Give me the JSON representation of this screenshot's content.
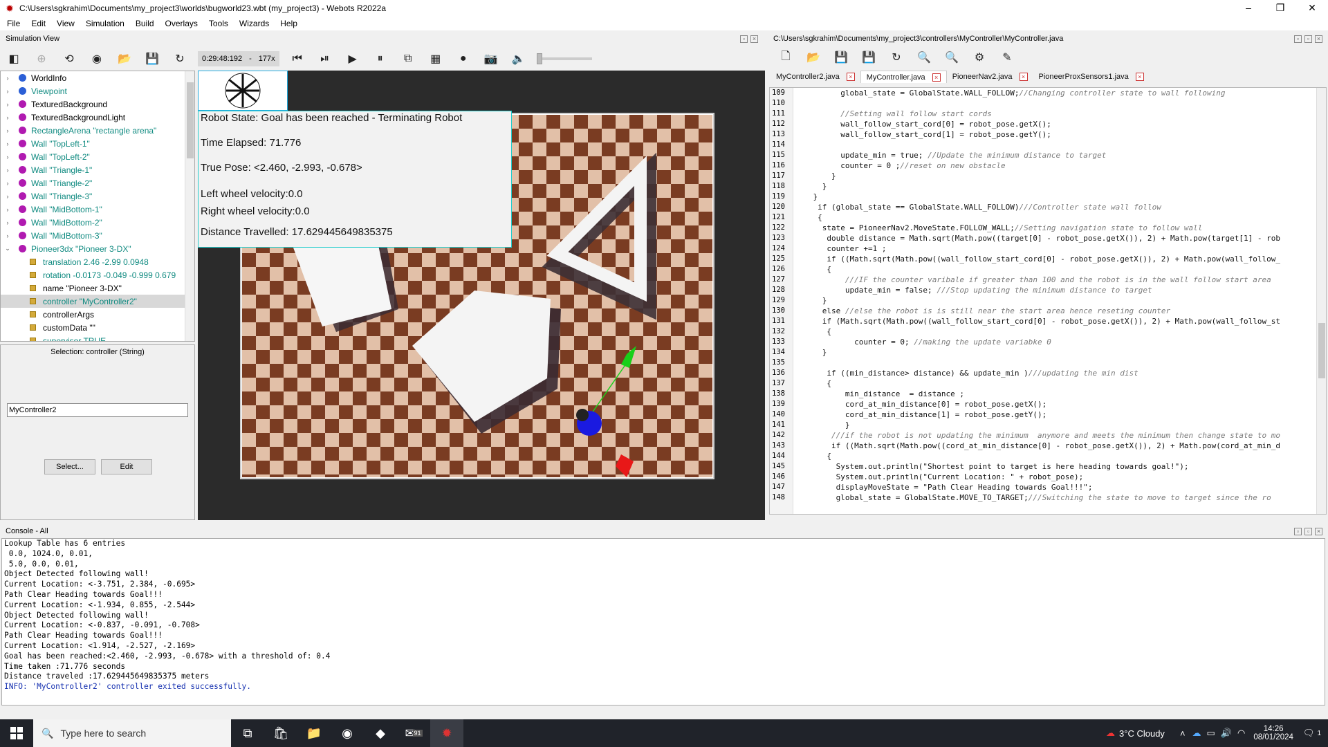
{
  "window": {
    "title": "C:\\Users\\sgkrahim\\Documents\\my_project3\\worlds\\bugworld23.wbt (my_project3) - Webots R2022a"
  },
  "menu": [
    "File",
    "Edit",
    "View",
    "Simulation",
    "Build",
    "Overlays",
    "Tools",
    "Wizards",
    "Help"
  ],
  "simulation": {
    "panel_title": "Simulation View",
    "time": "0:29:48:192",
    "sep": "-",
    "speed": "177x"
  },
  "scene_tree": [
    {
      "label": "WorldInfo",
      "color": "#2b5fd6",
      "type": "node",
      "expand": "›"
    },
    {
      "label": "Viewpoint",
      "color": "#2b5fd6",
      "type": "node",
      "expand": "›",
      "teal": true
    },
    {
      "label": "TexturedBackground",
      "color": "#b01ab0",
      "type": "node",
      "expand": "›"
    },
    {
      "label": "TexturedBackgroundLight",
      "color": "#b01ab0",
      "type": "node",
      "expand": "›"
    },
    {
      "label": "RectangleArena \"rectangle arena\"",
      "color": "#b01ab0",
      "type": "node",
      "expand": "›",
      "teal": true
    },
    {
      "label": "Wall \"TopLeft-1\"",
      "color": "#b01ab0",
      "type": "node",
      "expand": "›",
      "teal": true
    },
    {
      "label": "Wall \"TopLeft-2\"",
      "color": "#b01ab0",
      "type": "node",
      "expand": "›",
      "teal": true
    },
    {
      "label": "Wall \"Triangle-1\"",
      "color": "#b01ab0",
      "type": "node",
      "expand": "›",
      "teal": true
    },
    {
      "label": "Wall \"Triangle-2\"",
      "color": "#b01ab0",
      "type": "node",
      "expand": "›",
      "teal": true
    },
    {
      "label": "Wall \"Triangle-3\"",
      "color": "#b01ab0",
      "type": "node",
      "expand": "›",
      "teal": true
    },
    {
      "label": "Wall \"MidBottom-1\"",
      "color": "#b01ab0",
      "type": "node",
      "expand": "›",
      "teal": true
    },
    {
      "label": "Wall \"MidBottom-2\"",
      "color": "#b01ab0",
      "type": "node",
      "expand": "›",
      "teal": true
    },
    {
      "label": "Wall \"MidBottom-3\"",
      "color": "#b01ab0",
      "type": "node",
      "expand": "›",
      "teal": true
    },
    {
      "label": "Pioneer3dx \"Pioneer 3-DX\"",
      "color": "#b01ab0",
      "type": "node",
      "expand": "⌄",
      "teal": true
    },
    {
      "label": "translation 2.46 -2.99 0.0948",
      "type": "field",
      "teal": true
    },
    {
      "label": "rotation -0.0173 -0.049 -0.999 0.679",
      "type": "field",
      "teal": true
    },
    {
      "label": "name \"Pioneer 3-DX\"",
      "type": "field"
    },
    {
      "label": "controller \"MyController2\"",
      "type": "field",
      "teal": true,
      "selected": true
    },
    {
      "label": "controllerArgs",
      "type": "field"
    },
    {
      "label": "customData \"\"",
      "type": "field"
    },
    {
      "label": "supervisor TRUE",
      "type": "field",
      "teal": true
    }
  ],
  "selection": {
    "label": "Selection: controller (String)",
    "value": "MyController2",
    "select_button": "Select...",
    "edit_button": "Edit"
  },
  "overlay": {
    "state": "Robot State: Goal has been reached - Terminating Robot",
    "time_elapsed": "Time Elapsed: 71.776",
    "true_pose": "True Pose: <2.460, -2.993, -0.678>",
    "left_wheel": "Left wheel velocity:0.0",
    "right_wheel": "Right wheel velocity:0.0",
    "distance": "Distance Travelled: 17.629445649835375"
  },
  "editor": {
    "path": "C:\\Users\\sgkrahim\\Documents\\my_project3\\controllers\\MyController\\MyController.java",
    "tabs": [
      {
        "label": "MyController2.java",
        "active": false
      },
      {
        "label": "MyController.java",
        "active": true
      },
      {
        "label": "PioneerNav2.java",
        "active": false
      },
      {
        "label": "PioneerProxSensors1.java",
        "active": false
      }
    ],
    "line_numbers": [
      "109",
      "110",
      "111",
      "112",
      "113",
      "114",
      "115",
      "116",
      "117",
      "118",
      "119",
      "120",
      "121",
      "122",
      "123",
      "124",
      "125",
      "126",
      "127",
      "128",
      "129",
      "130",
      "131",
      "132",
      "133",
      "134",
      "135",
      "136",
      "137",
      "138",
      "139",
      "140",
      "141",
      "142",
      "143",
      "144",
      "145",
      "146",
      "147",
      "148"
    ],
    "lines": [
      "          global_state = GlobalState.WALL_FOLLOW;//Changing controller state to wall following",
      "",
      "          //Setting wall follow start cords",
      "          wall_follow_start_cord[0] = robot_pose.getX();",
      "          wall_follow_start_cord[1] = robot_pose.getY();",
      "",
      "          update_min = true; //Update the minimum distance to target",
      "          counter = 0 ;//reset on new obstacle",
      "        }",
      "      }",
      "    }",
      "     if (global_state == GlobalState.WALL_FOLLOW)///Controller state wall follow",
      "     {",
      "      state = PioneerNav2.MoveState.FOLLOW_WALL;//Setting navigation state to follow wall",
      "       double distance = Math.sqrt(Math.pow((target[0] - robot_pose.getX()), 2) + Math.pow(target[1] - rob",
      "       counter +=1 ;",
      "       if ((Math.sqrt(Math.pow((wall_follow_start_cord[0] - robot_pose.getX()), 2) + Math.pow(wall_follow_",
      "       {",
      "           ///IF the counter varibale if greater than 100 and the robot is in the wall follow start area",
      "           update_min = false; ///Stop updating the minimum distance to target",
      "      }",
      "      else //else the robot is is still near the start area hence reseting counter",
      "      if (Math.sqrt(Math.pow((wall_follow_start_cord[0] - robot_pose.getX()), 2) + Math.pow(wall_follow_st",
      "       {",
      "             counter = 0; //making the update variabke 0",
      "      }",
      "",
      "       if ((min_distance> distance) && update_min )///updating the min dist",
      "       {",
      "           min_distance  = distance ;",
      "           cord_at_min_distance[0] = robot_pose.getX();",
      "           cord_at_min_distance[1] = robot_pose.getY();",
      "           }",
      "        ///if the robot is not updating the minimum  anymore and meets the minimum then change state to mo",
      "        if ((Math.sqrt(Math.pow((cord_at_min_distance[0] - robot_pose.getX()), 2) + Math.pow(cord_at_min_d",
      "       {",
      "         System.out.println(\"Shortest point to target is here heading towards goal!\");",
      "         System.out.println(\"Current Location: \" + robot_pose);",
      "         displayMoveState = \"Path Clear Heading towards Goal!!!\";",
      "         global_state = GlobalState.MOVE_TO_TARGET;///Switching the state to move to target since the ro"
    ]
  },
  "console": {
    "title": "Console - All",
    "lines": [
      "Lookup Table has 6 entries",
      " 0.0, 1024.0, 0.01,",
      " 5.0, 0.0, 0.01,",
      "Object Detected following wall!",
      "Current Location: <-3.751, 2.384, -0.695>",
      "Path Clear Heading towards Goal!!!",
      "Current Location: <-1.934, 0.855, -2.544>",
      "Object Detected following wall!",
      "Current Location: <-0.837, -0.091, -0.708>",
      "Path Clear Heading towards Goal!!!",
      "Current Location: <1.914, -2.527, -2.169>",
      "Goal has been reached:<2.460, -2.993, -0.678> with a threshold of: 0.4",
      "Time taken :71.776 seconds",
      "Distance traveled :17.629445649835375 meters"
    ],
    "info_line": "INFO: 'MyController2' controller exited successfully."
  },
  "taskbar": {
    "search_placeholder": "Type here to search",
    "weather": "3°C  Cloudy",
    "time": "14:26",
    "date": "08/01/2024",
    "mail_badge": "91",
    "notif_badge": "1"
  }
}
